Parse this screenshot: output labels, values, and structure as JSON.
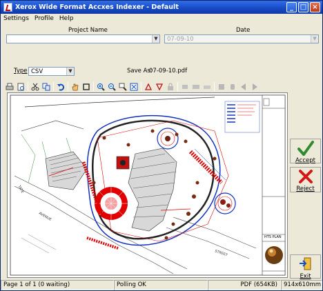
{
  "window": {
    "title": "Xerox Wide Format Accxes Indexer - Default"
  },
  "menu": [
    "Settings",
    "Profile",
    "Help"
  ],
  "form": {
    "project_label": "Project Name",
    "project_value": "",
    "date_label": "Date",
    "date_value": "07-09-10",
    "type_label": "Type",
    "type_value": "CSV",
    "save_as_label": "Save As:",
    "save_as_value": "07-09-10.pdf"
  },
  "toolbar_icons": [
    "print-icon",
    "print-preview-icon",
    "cut-icon",
    "copy-icon",
    "undo-icon",
    "pan-hand-icon",
    "select-rect-icon",
    "zoom-in-icon",
    "zoom-out-icon",
    "zoom-window-icon",
    "zoom-fit-icon",
    "rotate-left-icon",
    "rotate-right-icon",
    "lock-icon",
    "view-one-icon",
    "view-two-icon",
    "view-three-icon",
    "stamp-icon",
    "thumbnail-icon",
    "previous-page-icon",
    "next-page-icon"
  ],
  "drawing": {
    "title_block_name": "HTS PLAN",
    "street_labels": [
      "AVENUE",
      "STREET",
      "TATE"
    ]
  },
  "actions": {
    "accept": "Accept",
    "reject": "Reject",
    "exit": "Exit"
  },
  "status": {
    "page": "Page 1 of 1 (0 waiting)",
    "polling": "Polling OK",
    "file": "PDF (654KB)",
    "size": "914x610mm"
  },
  "colors": {
    "titlebar": "#1748c4",
    "accept": "#2e8b2e",
    "reject": "#d01818",
    "plan_red": "#e00000",
    "plan_blue": "#1030c0"
  }
}
